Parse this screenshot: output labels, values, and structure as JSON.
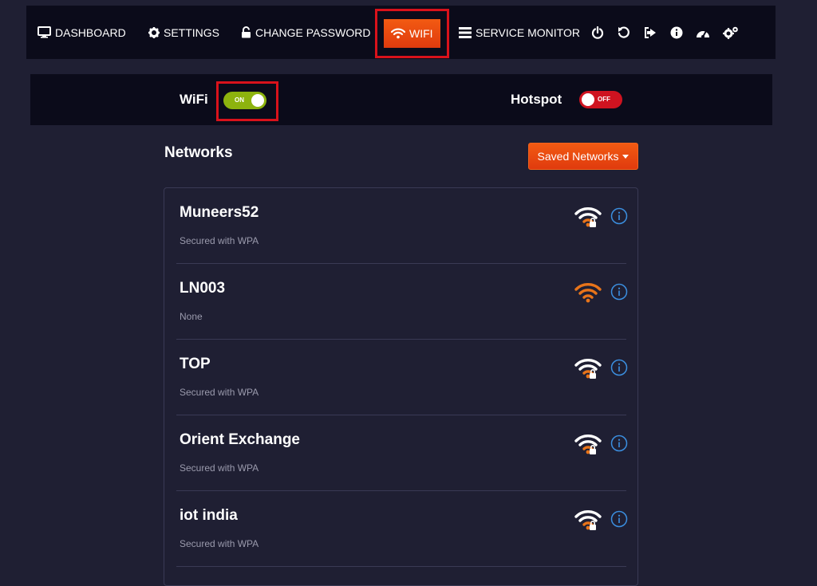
{
  "nav": {
    "dashboard": "DASHBOARD",
    "settings": "SETTINGS",
    "change_password": "CHANGE PASSWORD",
    "wifi": "WIFI",
    "service_monitor": "SERVICE MONITOR",
    "icons": [
      "power-icon",
      "restart-icon",
      "logout-icon",
      "info-icon",
      "speedometer-icon",
      "cogs-icon"
    ]
  },
  "toggles": {
    "wifi_label": "WiFi",
    "wifi_state": "ON",
    "hotspot_label": "Hotspot",
    "hotspot_state": "OFF"
  },
  "networks": {
    "title": "Networks",
    "saved_button": "Saved Networks",
    "items": [
      {
        "name": "Muneers52",
        "security": "Secured with WPA",
        "signal_color": "#ffffff",
        "locked": true
      },
      {
        "name": "LN003",
        "security": "None",
        "signal_color": "#e8741a",
        "locked": false
      },
      {
        "name": "TOP",
        "security": "Secured with WPA",
        "signal_color": "#ffffff",
        "locked": true
      },
      {
        "name": "Orient Exchange",
        "security": "Secured with WPA",
        "signal_color": "#ffffff",
        "locked": true
      },
      {
        "name": "iot india",
        "security": "Secured with WPA",
        "signal_color": "#ffffff",
        "locked": true
      }
    ]
  },
  "colors": {
    "accent": "#e8480f",
    "highlight_border": "#d9121b",
    "switch_on": "#8db30e",
    "switch_off": "#cf1320",
    "info_icon": "#3b8fe0",
    "wifi_partial": "#e8741a"
  }
}
